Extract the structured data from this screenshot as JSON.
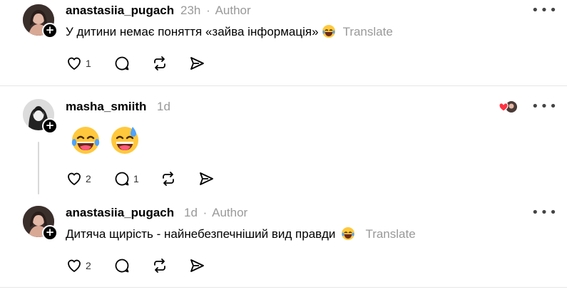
{
  "posts": [
    {
      "username": "anastasiia_pugach",
      "time": "23h",
      "sep": "·",
      "badge": "Author",
      "text": "У дитини немає поняття «зайва інформація»",
      "translate": "Translate",
      "likes": "1",
      "replies": ""
    },
    {
      "username": "masha_smiith",
      "time": "1d",
      "text": "",
      "likes": "2",
      "replies": "1"
    },
    {
      "username": "anastasiia_pugach",
      "time": "1d",
      "sep": "·",
      "badge": "Author",
      "text": "Дитяча щирість - найнебезпечніший вид правди",
      "translate": "Translate",
      "likes": "2",
      "replies": ""
    }
  ],
  "icons": {
    "more": "more-icon",
    "like": "heart-icon",
    "reply": "comment-icon",
    "repost": "repost-icon",
    "share": "send-icon",
    "follow": "plus-icon",
    "liked_by_author": "author-liked-icon"
  },
  "more_glyph": "•••",
  "colors": {
    "muted": "#999999",
    "like_red": "#ff3040",
    "emoji_yellow": "#ffc83d"
  }
}
